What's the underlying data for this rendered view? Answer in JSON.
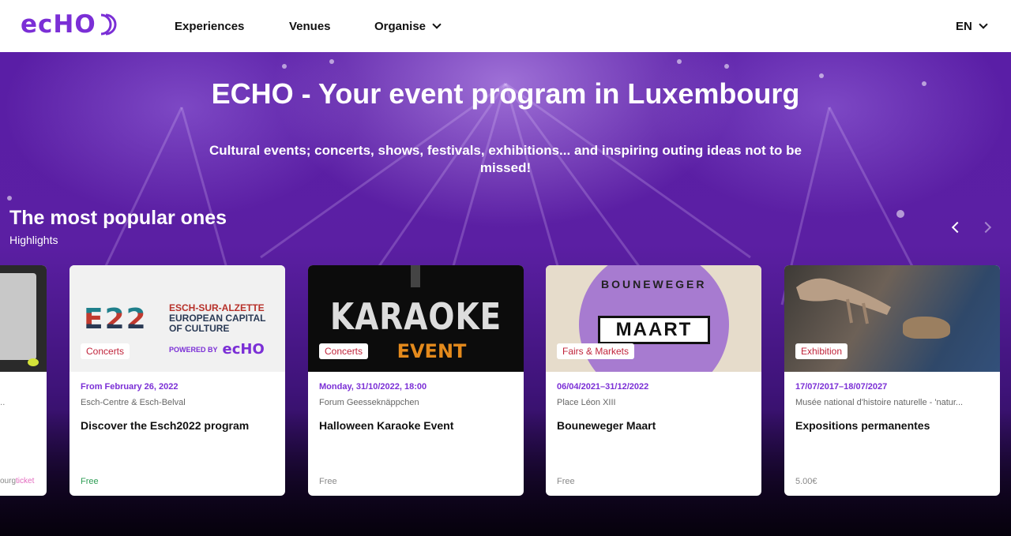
{
  "header": {
    "logo_text": "ecHO",
    "nav": {
      "experiences": "Experiences",
      "venues": "Venues",
      "organise": "Organise"
    },
    "language": "EN"
  },
  "hero": {
    "title": "ECHO - Your event program in Luxembourg",
    "subtitle": "Cultural events; concerts, shows, festivals, exhibitions... and inspiring outing ideas not to be missed!"
  },
  "section": {
    "title": "The most popular ones",
    "subtitle": "Highlights"
  },
  "cards": [
    {
      "venue": "e...",
      "ticket_prefix": "ourg",
      "ticket_suffix": "ticket"
    },
    {
      "tag": "Concerts",
      "date": "From February 26, 2022",
      "venue": "Esch-Centre & Esch-Belval",
      "title": "Discover the Esch2022 program",
      "price": "Free",
      "art": {
        "logo": "E22",
        "line1": "ESCH-SUR-ALZETTE",
        "line2": "EUROPEAN CAPITAL",
        "line3": "OF CULTURE",
        "powered": "POWERED BY",
        "echo": "ecHO"
      }
    },
    {
      "tag": "Concerts",
      "date": "Monday, 31/10/2022, 18:00",
      "venue": "Forum Geesseknäppchen",
      "title": "Halloween Karaoke Event",
      "price": "Free",
      "art": {
        "word1": "KARAOKE",
        "word2": "EVENT"
      }
    },
    {
      "tag": "Fairs & Markets",
      "date": "06/04/2021–31/12/2022",
      "venue": "Place Léon XIII",
      "title": "Bouneweger Maart",
      "price": "Free",
      "art": {
        "arc": "BOUNEWEGER",
        "box": "MAART"
      }
    },
    {
      "tag": "Exhibition",
      "date": "17/07/2017–18/07/2027",
      "venue": "Musée national d'histoire naturelle - 'natur...",
      "title": "Expositions permanentes",
      "price": "5.00€"
    }
  ],
  "colors": {
    "brand": "#7b2fd6",
    "tag_text": "#c0243b",
    "free_green": "#2e9d55"
  }
}
